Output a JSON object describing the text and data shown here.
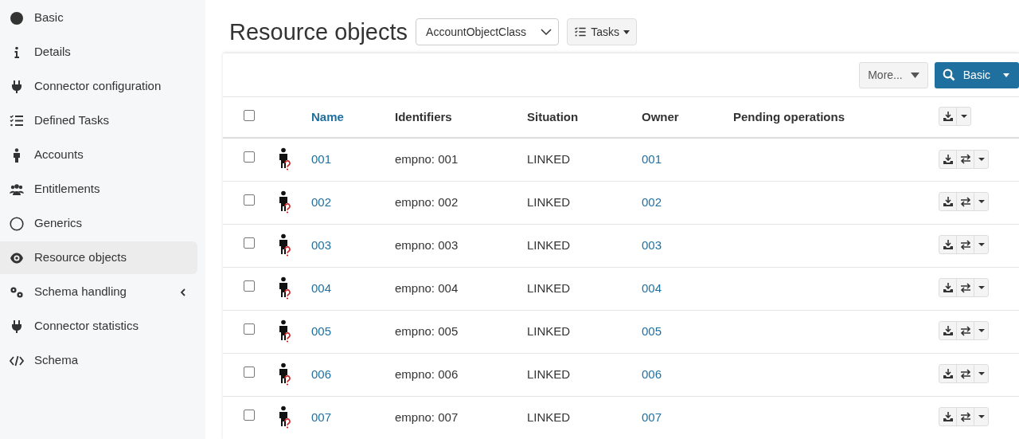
{
  "sidebar": {
    "items": [
      {
        "label": "Basic",
        "selected": false
      },
      {
        "label": "Details",
        "selected": false
      },
      {
        "label": "Connector configuration",
        "selected": false
      },
      {
        "label": "Defined Tasks",
        "selected": false
      },
      {
        "label": "Accounts",
        "selected": false
      },
      {
        "label": "Entitlements",
        "selected": false
      },
      {
        "label": "Generics",
        "selected": false
      },
      {
        "label": "Resource objects",
        "selected": true
      },
      {
        "label": "Schema handling",
        "selected": false,
        "expanded": false
      },
      {
        "label": "Connector statistics",
        "selected": false
      },
      {
        "label": "Schema",
        "selected": false
      }
    ]
  },
  "header": {
    "title": "Resource objects",
    "object_class": "AccountObjectClass",
    "tasks_button": "Tasks"
  },
  "toolbar": {
    "more_button": "More...",
    "search_button": "Basic"
  },
  "table": {
    "all_checked": false,
    "columns": [
      {
        "label": "Name",
        "sortable": true
      },
      {
        "label": "Identifiers",
        "sortable": false
      },
      {
        "label": "Situation",
        "sortable": false
      },
      {
        "label": "Owner",
        "sortable": false
      },
      {
        "label": "Pending operations",
        "sortable": false
      }
    ],
    "rows": [
      {
        "checked": false,
        "name": "001",
        "identifiers": "empno: 001",
        "situation": "LINKED",
        "owner": "001"
      },
      {
        "checked": false,
        "name": "002",
        "identifiers": "empno: 002",
        "situation": "LINKED",
        "owner": "002"
      },
      {
        "checked": false,
        "name": "003",
        "identifiers": "empno: 003",
        "situation": "LINKED",
        "owner": "003"
      },
      {
        "checked": false,
        "name": "004",
        "identifiers": "empno: 004",
        "situation": "LINKED",
        "owner": "004"
      },
      {
        "checked": false,
        "name": "005",
        "identifiers": "empno: 005",
        "situation": "LINKED",
        "owner": "005"
      },
      {
        "checked": false,
        "name": "006",
        "identifiers": "empno: 006",
        "situation": "LINKED",
        "owner": "006"
      },
      {
        "checked": false,
        "name": "007",
        "identifiers": "empno: 007",
        "situation": "LINKED",
        "owner": "007"
      }
    ]
  }
}
